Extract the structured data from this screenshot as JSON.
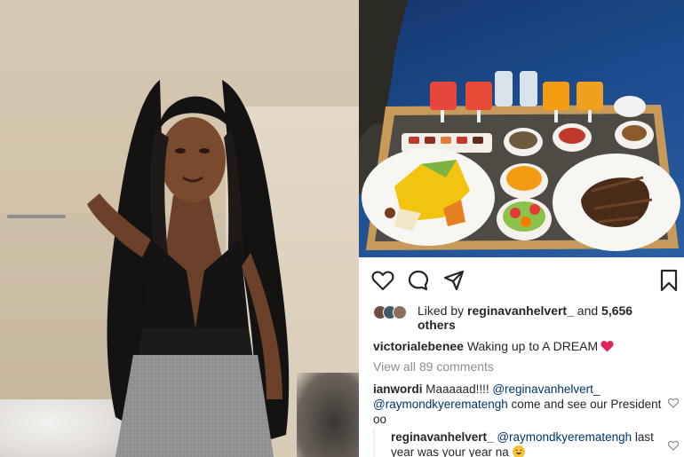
{
  "post": {
    "liked_prefix": "Liked by",
    "liked_by_user": "reginavanhelvert_",
    "liked_and": "and",
    "likes_count": "5,656",
    "likes_others": "others",
    "caption_user": "victorialebenee",
    "caption_text": "Waking up to A DREAM",
    "view_all_comments": "View all 89 comments"
  },
  "comments": [
    {
      "user": "ianwordi",
      "text_before": "Maaaaad!!!!",
      "mentions": [
        "@reginavanhelvert_",
        "@raymondkyerematengh"
      ],
      "text_after": "come and see our President oo"
    },
    {
      "user": "reginavanhelvert_",
      "mention": "@raymondkyerematengh",
      "text": "last year was your year na"
    }
  ],
  "icons": {
    "like": "heart-outline-icon",
    "comment": "comment-bubble-icon",
    "share": "paper-plane-icon",
    "save": "bookmark-icon"
  },
  "colors": {
    "text": "#262626",
    "muted": "#8e8e8e",
    "mention": "#003569",
    "heart_emoji": "#e0245e"
  }
}
